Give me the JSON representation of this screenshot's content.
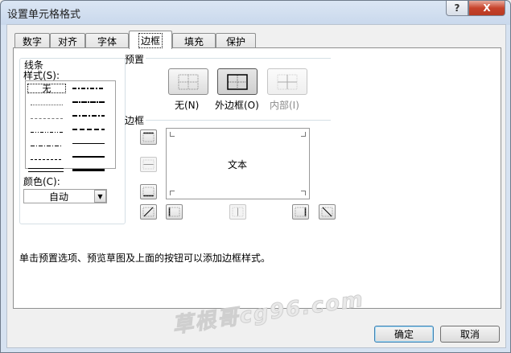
{
  "window": {
    "title": "设置单元格格式",
    "help": "?",
    "close": "X"
  },
  "tabs": [
    {
      "label": "数字"
    },
    {
      "label": "对齐"
    },
    {
      "label": "字体"
    },
    {
      "label": "边框"
    },
    {
      "label": "填充"
    },
    {
      "label": "保护"
    }
  ],
  "active_tab": "边框",
  "line": {
    "group_label": "线条",
    "style_label": "样式(S):",
    "none_label": "无",
    "color_label": "颜色(C):",
    "color_value": "自动"
  },
  "presets": {
    "label": "预置",
    "items": [
      {
        "label": "无(N)",
        "icon": "no-border-icon"
      },
      {
        "label": "外边框(O)",
        "icon": "outline-border-icon"
      },
      {
        "label": "内部(I)",
        "icon": "inside-border-icon"
      }
    ]
  },
  "border": {
    "label": "边框",
    "preview_text": "文本",
    "buttons": [
      "top-border-icon",
      "inside-horizontal-icon",
      "bottom-border-icon",
      "diagonal-up-icon",
      "left-border-icon",
      "inside-vertical-icon",
      "right-border-icon",
      "diagonal-down-icon"
    ]
  },
  "description": "单击预置选项、预览草图及上面的按钮可以添加边框样式。",
  "watermark": "草根哥cg96.com",
  "buttons": {
    "ok": "确定",
    "cancel": "取消"
  }
}
